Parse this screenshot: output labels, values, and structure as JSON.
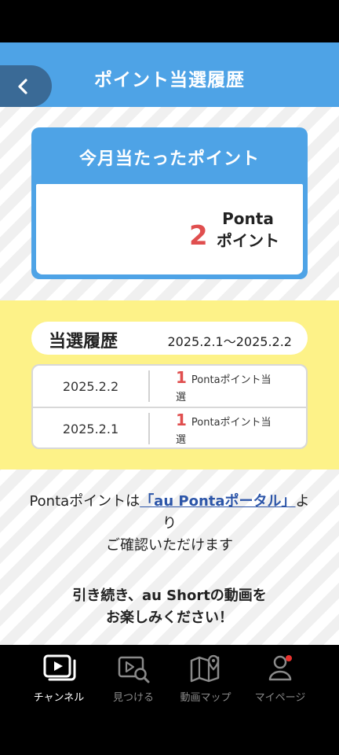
{
  "header": {
    "title": "ポイント当選履歴",
    "back_icon": "chevron-left-icon"
  },
  "month_card": {
    "title": "今月当たったポイント",
    "points": "2",
    "unit_line1": "Ponta",
    "unit_line2": "ポイント"
  },
  "history": {
    "title": "当選履歴",
    "range": "2025.2.1～2025.2.2",
    "rows": [
      {
        "date": "2025.2.2",
        "count": "1",
        "desc_a": "Pontaポイント当",
        "desc_b": "選"
      },
      {
        "date": "2025.2.1",
        "count": "1",
        "desc_a": "Pontaポイント当",
        "desc_b": "選"
      }
    ]
  },
  "info": {
    "prefix": "Pontaポイントは",
    "link": "「au Pontaポータル」",
    "suffix_a": "よ",
    "suffix_b": "り",
    "line2": "ご確認いただけます"
  },
  "closing": {
    "line1": "引き続き、au Shortの動画を",
    "line2": "お楽しみください！"
  },
  "nav": {
    "items": [
      {
        "label": "チャンネル",
        "icon": "play-screen-icon",
        "active": true
      },
      {
        "label": "見つける",
        "icon": "video-search-icon",
        "active": false
      },
      {
        "label": "動画マップ",
        "icon": "map-pin-icon",
        "active": false
      },
      {
        "label": "マイページ",
        "icon": "person-icon",
        "active": false,
        "badge": true
      }
    ]
  },
  "colors": {
    "brand_blue": "#4ea3e6",
    "back_button": "#3a6a96",
    "highlight_yellow": "#fdf288",
    "points_red": "#e04f4f",
    "link_blue": "#2c55a8",
    "badge_red": "#e8322e"
  }
}
